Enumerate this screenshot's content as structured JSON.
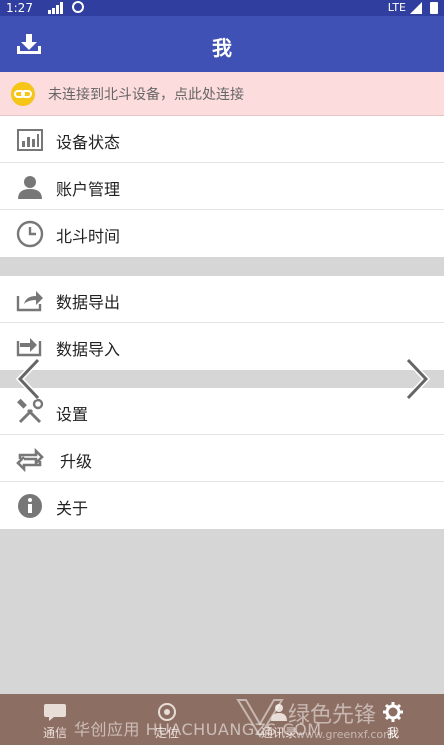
{
  "status_bar": {
    "time": "1:27",
    "network": "LTE"
  },
  "app_bar": {
    "title": "我",
    "left_icon": "download-icon"
  },
  "banner": {
    "text": "未连接到北斗设备，点此处连接",
    "icon": "link-icon",
    "icon_color": "#f5c518"
  },
  "group1": [
    {
      "label": "设备状态",
      "icon": "chart-icon"
    },
    {
      "label": "账户管理",
      "icon": "person-icon"
    },
    {
      "label": "北斗时间",
      "icon": "clock-icon"
    }
  ],
  "group2": [
    {
      "label": "数据导出",
      "icon": "export-icon"
    },
    {
      "label": "数据导入",
      "icon": "import-icon"
    }
  ],
  "group3": [
    {
      "label": "设置",
      "icon": "tools-icon"
    },
    {
      "label": "升级",
      "icon": "refresh-icon"
    },
    {
      "label": "关于",
      "icon": "info-icon"
    }
  ],
  "tabs": [
    {
      "label": "通信",
      "icon": "chat-icon"
    },
    {
      "label": "定位",
      "icon": "location-icon"
    },
    {
      "label": "通讯录",
      "icon": "contacts-icon"
    },
    {
      "label": "我",
      "icon": "gear-icon",
      "active": true
    }
  ],
  "watermark": {
    "text": "华创应用 HUACHUANGZS.COM",
    "brand": "绿色先锋",
    "url": "www.greenxf.com"
  },
  "colors": {
    "primary": "#3f51b5",
    "status_bar": "#303f9f",
    "banner": "#fcdcdc",
    "bottom_bar": "#8d6e63"
  }
}
